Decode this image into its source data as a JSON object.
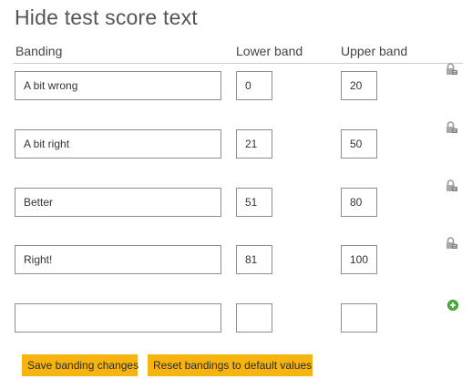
{
  "page": {
    "title": "Hide test score text"
  },
  "columns": {
    "banding": "Banding",
    "lower": "Lower band",
    "upper": "Upper band"
  },
  "bands": [
    {
      "name": "A bit wrong",
      "lower": "0",
      "upper": "20",
      "icon": "lock-icon"
    },
    {
      "name": "A bit right",
      "lower": "21",
      "upper": "50",
      "icon": "lock-icon"
    },
    {
      "name": "Better",
      "lower": "51",
      "upper": "80",
      "icon": "lock-icon"
    },
    {
      "name": "Right!",
      "lower": "81",
      "upper": "100",
      "icon": "lock-icon"
    }
  ],
  "new_band": {
    "name": "",
    "lower": "",
    "upper": "",
    "icon": "add-icon"
  },
  "buttons": {
    "save": "Save banding changes",
    "reset": "Reset bandings to default values"
  },
  "colors": {
    "accent": "#f8b40e",
    "add_icon": "#4caf3a",
    "lock_icon": "#9a9a9a"
  }
}
